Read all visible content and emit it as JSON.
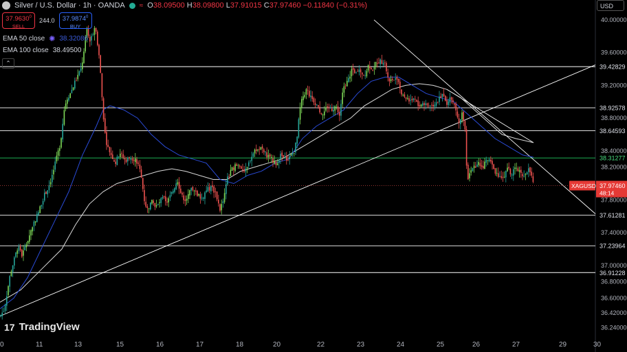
{
  "header": {
    "title": "Silver / U.S. Dollar · 1h · OANDA",
    "open_label": "O",
    "open": "38.09500",
    "high_label": "H",
    "high": "38.09800",
    "low_label": "L",
    "low": "37.91015",
    "close_label": "C",
    "close": "37.97460",
    "change": "−0.11840 (−0.31%)"
  },
  "trade": {
    "sell_price": "37.9630",
    "sell_sup": "0",
    "sell_label": "SELL",
    "spread": "244.0",
    "buy_price": "37.9874",
    "buy_sup": "0",
    "buy_label": "BUY"
  },
  "ema50": {
    "label": "EMA 50 close",
    "value": "38.32086",
    "color": "#2a4bd7"
  },
  "ema100": {
    "label": "EMA 100 close",
    "value": "38.49500",
    "color": "#d9d9d9"
  },
  "collapse_icon": "chevron-up-icon",
  "currency": "USD",
  "logo_text": "TradingView",
  "colors": {
    "up": "#26a69a",
    "down": "#ef5350",
    "up_bright": "#7ed957",
    "bg": "#000000"
  },
  "price_tag": {
    "symbol": "XAGUSD",
    "price": "37.97460",
    "countdown": "48:14"
  },
  "chart_data": {
    "type": "candlestick",
    "timeframe": "1h",
    "ylim": [
      36.16,
      40.1
    ],
    "y_ticks": [
      "40.00000",
      "39.60000",
      "39.20000",
      "38.80000",
      "38.40000",
      "38.20000",
      "37.80000",
      "37.40000",
      "37.00000",
      "36.80000",
      "36.60000",
      "36.42000",
      "36.24000"
    ],
    "x_ticks": [
      "0",
      "11",
      "13",
      "15",
      "16",
      "17",
      "18",
      "20",
      "22",
      "23",
      "24",
      "25",
      "26",
      "27",
      "29",
      "30"
    ],
    "horizontal_levels": [
      {
        "value": 39.42829,
        "label": "39.42829",
        "color": "#ffffff"
      },
      {
        "value": 38.92578,
        "label": "38.92578",
        "color": "#ffffff"
      },
      {
        "value": 38.64593,
        "label": "38.64593",
        "color": "#ffffff"
      },
      {
        "value": 38.31277,
        "label": "38.31277",
        "color": "#22c55e"
      },
      {
        "value": 37.61281,
        "label": "37.61281",
        "color": "#ffffff"
      },
      {
        "value": 37.23964,
        "label": "37.23964",
        "color": "#ffffff"
      },
      {
        "value": 36.91228,
        "label": "36.91228",
        "color": "#ffffff"
      }
    ],
    "close_path": [
      [
        0,
        36.38
      ],
      [
        6,
        36.46
      ],
      [
        11,
        36.7
      ],
      [
        15,
        36.9
      ],
      [
        20,
        37.05
      ],
      [
        26,
        37.23
      ],
      [
        32,
        37.12
      ],
      [
        40,
        37.3
      ],
      [
        48,
        37.5
      ],
      [
        56,
        37.65
      ],
      [
        64,
        37.85
      ],
      [
        70,
        37.95
      ],
      [
        76,
        38.1
      ],
      [
        82,
        38.3
      ],
      [
        88,
        38.5
      ],
      [
        94,
        38.95
      ],
      [
        98,
        39.05
      ],
      [
        102,
        39.1
      ],
      [
        107,
        39.2
      ],
      [
        112,
        39.3
      ],
      [
        118,
        39.4
      ],
      [
        122,
        39.6
      ],
      [
        126,
        39.9
      ],
      [
        130,
        39.75
      ],
      [
        134,
        39.8
      ],
      [
        138,
        39.95
      ],
      [
        142,
        39.7
      ],
      [
        145,
        39.5
      ],
      [
        148,
        39.1
      ],
      [
        152,
        38.65
      ],
      [
        156,
        38.45
      ],
      [
        162,
        38.35
      ],
      [
        168,
        38.25
      ],
      [
        174,
        38.38
      ],
      [
        182,
        38.28
      ],
      [
        190,
        38.32
      ],
      [
        196,
        38.3
      ],
      [
        202,
        38.22
      ],
      [
        206,
        38.05
      ],
      [
        210,
        37.8
      ],
      [
        214,
        37.68
      ],
      [
        220,
        37.78
      ],
      [
        228,
        37.72
      ],
      [
        236,
        37.82
      ],
      [
        244,
        37.78
      ],
      [
        252,
        37.92
      ],
      [
        258,
        38.05
      ],
      [
        264,
        37.85
      ],
      [
        270,
        37.8
      ],
      [
        278,
        37.92
      ],
      [
        286,
        37.88
      ],
      [
        294,
        37.82
      ],
      [
        300,
        37.92
      ],
      [
        308,
        37.95
      ],
      [
        314,
        37.88
      ],
      [
        320,
        37.68
      ],
      [
        326,
        37.85
      ],
      [
        330,
        38.05
      ],
      [
        336,
        38.15
      ],
      [
        342,
        38.22
      ],
      [
        350,
        38.2
      ],
      [
        358,
        38.15
      ],
      [
        364,
        38.3
      ],
      [
        370,
        38.4
      ],
      [
        376,
        38.45
      ],
      [
        382,
        38.4
      ],
      [
        388,
        38.35
      ],
      [
        394,
        38.3
      ],
      [
        402,
        38.25
      ],
      [
        408,
        38.35
      ],
      [
        414,
        38.3
      ],
      [
        420,
        38.3
      ],
      [
        428,
        38.4
      ],
      [
        432,
        38.55
      ],
      [
        436,
        38.9
      ],
      [
        440,
        39.05
      ],
      [
        446,
        39.15
      ],
      [
        452,
        39.05
      ],
      [
        458,
        39.0
      ],
      [
        464,
        38.9
      ],
      [
        470,
        38.85
      ],
      [
        476,
        38.95
      ],
      [
        482,
        38.9
      ],
      [
        488,
        38.95
      ],
      [
        494,
        38.85
      ],
      [
        500,
        39.2
      ],
      [
        506,
        39.25
      ],
      [
        512,
        39.4
      ],
      [
        518,
        39.35
      ],
      [
        524,
        39.38
      ],
      [
        530,
        39.32
      ],
      [
        536,
        39.45
      ],
      [
        542,
        39.4
      ],
      [
        548,
        39.48
      ],
      [
        554,
        39.5
      ],
      [
        560,
        39.45
      ],
      [
        566,
        39.25
      ],
      [
        572,
        39.28
      ],
      [
        578,
        39.3
      ],
      [
        584,
        39.1
      ],
      [
        590,
        39.05
      ],
      [
        596,
        39.02
      ],
      [
        602,
        39.05
      ],
      [
        608,
        38.95
      ],
      [
        614,
        38.98
      ],
      [
        620,
        38.95
      ],
      [
        628,
        38.95
      ],
      [
        636,
        39.0
      ],
      [
        644,
        39.1
      ],
      [
        650,
        38.95
      ],
      [
        656,
        39.05
      ],
      [
        662,
        38.95
      ],
      [
        668,
        38.75
      ],
      [
        672,
        38.85
      ],
      [
        676,
        38.7
      ],
      [
        680,
        38.0
      ],
      [
        684,
        38.15
      ],
      [
        690,
        38.2
      ],
      [
        696,
        38.25
      ],
      [
        702,
        38.2
      ],
      [
        708,
        38.3
      ],
      [
        714,
        38.25
      ],
      [
        720,
        38.15
      ],
      [
        726,
        38.1
      ],
      [
        732,
        38.05
      ],
      [
        738,
        38.18
      ],
      [
        744,
        38.12
      ],
      [
        750,
        38.18
      ],
      [
        756,
        38.15
      ],
      [
        762,
        38.1
      ],
      [
        768,
        38.18
      ],
      [
        774,
        38.1
      ],
      [
        776,
        37.97
      ]
    ],
    "ema50_path": [
      [
        0,
        36.47
      ],
      [
        20,
        36.6
      ],
      [
        40,
        36.85
      ],
      [
        60,
        37.2
      ],
      [
        80,
        37.55
      ],
      [
        100,
        37.9
      ],
      [
        120,
        38.35
      ],
      [
        140,
        38.7
      ],
      [
        150,
        38.9
      ],
      [
        160,
        38.95
      ],
      [
        180,
        38.9
      ],
      [
        200,
        38.8
      ],
      [
        220,
        38.6
      ],
      [
        240,
        38.45
      ],
      [
        260,
        38.35
      ],
      [
        280,
        38.3
      ],
      [
        300,
        38.25
      ],
      [
        320,
        38.05
      ],
      [
        340,
        38.0
      ],
      [
        360,
        38.1
      ],
      [
        380,
        38.15
      ],
      [
        400,
        38.25
      ],
      [
        420,
        38.3
      ],
      [
        440,
        38.55
      ],
      [
        460,
        38.7
      ],
      [
        480,
        38.8
      ],
      [
        500,
        38.9
      ],
      [
        520,
        39.1
      ],
      [
        540,
        39.25
      ],
      [
        560,
        39.3
      ],
      [
        580,
        39.3
      ],
      [
        600,
        39.2
      ],
      [
        620,
        39.1
      ],
      [
        640,
        39.05
      ],
      [
        660,
        39.0
      ],
      [
        680,
        38.85
      ],
      [
        700,
        38.7
      ],
      [
        720,
        38.55
      ],
      [
        740,
        38.45
      ],
      [
        760,
        38.35
      ],
      [
        776,
        38.32
      ]
    ],
    "ema100_path": [
      [
        0,
        36.55
      ],
      [
        30,
        36.7
      ],
      [
        60,
        36.95
      ],
      [
        90,
        37.2
      ],
      [
        110,
        37.5
      ],
      [
        130,
        37.75
      ],
      [
        150,
        37.9
      ],
      [
        170,
        38.0
      ],
      [
        190,
        38.05
      ],
      [
        210,
        38.1
      ],
      [
        230,
        38.15
      ],
      [
        250,
        38.18
      ],
      [
        270,
        38.15
      ],
      [
        290,
        38.1
      ],
      [
        310,
        38.05
      ],
      [
        330,
        38.05
      ],
      [
        350,
        38.15
      ],
      [
        370,
        38.2
      ],
      [
        390,
        38.25
      ],
      [
        410,
        38.3
      ],
      [
        430,
        38.4
      ],
      [
        450,
        38.5
      ],
      [
        470,
        38.6
      ],
      [
        490,
        38.7
      ],
      [
        510,
        38.8
      ],
      [
        530,
        38.95
      ],
      [
        550,
        39.05
      ],
      [
        570,
        39.15
      ],
      [
        590,
        39.2
      ],
      [
        610,
        39.22
      ],
      [
        630,
        39.2
      ],
      [
        650,
        39.15
      ],
      [
        670,
        39.05
      ],
      [
        690,
        38.9
      ],
      [
        710,
        38.75
      ],
      [
        730,
        38.6
      ],
      [
        750,
        38.55
      ],
      [
        776,
        38.5
      ]
    ],
    "trendlines": [
      {
        "from": [
          0,
          36.38
        ],
        "to": [
          866,
          39.45
        ]
      },
      {
        "from": [
          544,
          40.0
        ],
        "to": [
          866,
          37.63
        ]
      },
      {
        "from": [
          650,
          39.15
        ],
        "to": [
          776,
          38.5
        ]
      }
    ]
  }
}
